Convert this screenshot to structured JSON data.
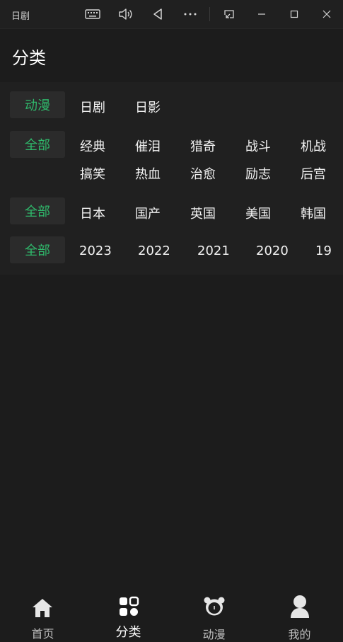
{
  "titlebar": {
    "app_title": "日剧",
    "icons": [
      "keyboard-icon",
      "speaker-icon",
      "back-triangle-icon",
      "more-icon",
      "pip-icon",
      "minimize-icon",
      "maximize-icon",
      "close-icon"
    ]
  },
  "page": {
    "title": "分类"
  },
  "filters": {
    "row1": {
      "selected": "动漫",
      "options": [
        "日剧",
        "日影"
      ]
    },
    "row2": {
      "selected": "全部",
      "options": [
        "经典",
        "催泪",
        "猎奇",
        "战斗",
        "机战",
        "搞笑",
        "热血",
        "治愈",
        "励志",
        "后宫"
      ]
    },
    "row3": {
      "selected": "全部",
      "options": [
        "日本",
        "国产",
        "英国",
        "美国",
        "韩国"
      ]
    },
    "row4": {
      "selected": "全部",
      "options": [
        "2023",
        "2022",
        "2021",
        "2020",
        "19"
      ]
    }
  },
  "bottom_nav": {
    "items": [
      {
        "label": "首页",
        "icon": "home-icon"
      },
      {
        "label": "分类",
        "icon": "category-grid-icon",
        "active": true
      },
      {
        "label": "动漫",
        "icon": "bear-icon"
      },
      {
        "label": "我的",
        "icon": "user-icon"
      }
    ]
  },
  "colors": {
    "accent": "#2fb96b",
    "background": "#1c1c1c",
    "panel": "#202020",
    "chip": "#2b2b2b"
  }
}
